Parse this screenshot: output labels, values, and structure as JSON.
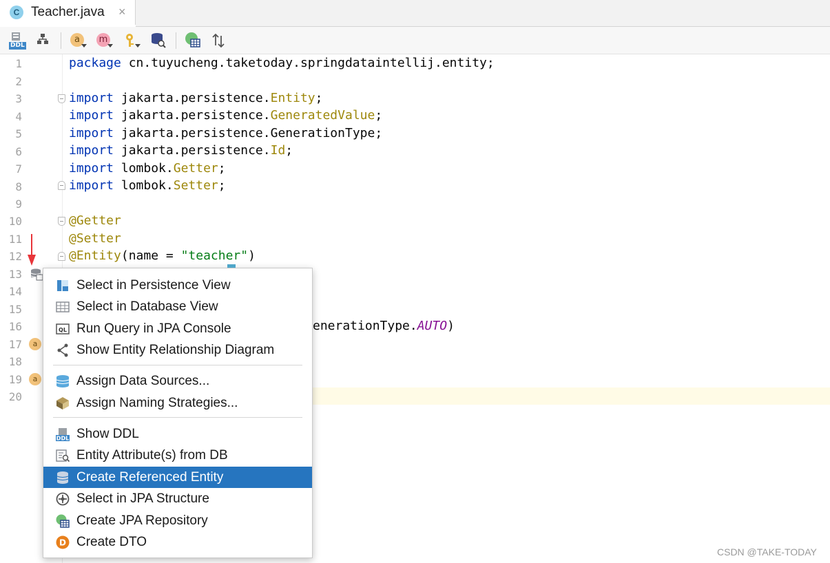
{
  "tab": {
    "title": "Teacher.java",
    "icon_letter": "C",
    "close_glyph": "×"
  },
  "toolbar": {
    "ddl_label": "DDL",
    "attribute_label": "a",
    "method_label": "m"
  },
  "editor": {
    "line_numbers": [
      "1",
      "2",
      "3",
      "4",
      "5",
      "6",
      "7",
      "8",
      "9",
      "10",
      "11",
      "12",
      "13",
      "14",
      "15",
      "16",
      "17",
      "18",
      "19",
      "20"
    ],
    "lines": {
      "l1": {
        "kw": "package",
        "rest": " cn.tuyucheng.taketoday.springdataintellij.entity;"
      },
      "l3": {
        "kw": "import",
        "pre": " jakarta.persistence.",
        "cls": "Entity",
        "post": ";"
      },
      "l4": {
        "kw": "import",
        "pre": " jakarta.persistence.",
        "cls": "GeneratedValue",
        "post": ";"
      },
      "l5": {
        "kw": "import",
        "pre": " jakarta.persistence.GenerationType;"
      },
      "l6": {
        "kw": "import",
        "pre": " jakarta.persistence.",
        "cls": "Id",
        "post": ";"
      },
      "l7": {
        "kw": "import",
        "pre": " lombok.",
        "cls": "Getter",
        "post": ";"
      },
      "l8": {
        "kw": "import",
        "pre": " lombok.",
        "cls": "Setter",
        "post": ";"
      },
      "l10": {
        "ann": "@Getter"
      },
      "l11": {
        "ann": "@Setter"
      },
      "l12": {
        "ann": "@Entity",
        "pre": "(name = ",
        "str": "\"teacher\"",
        "post": ")"
      },
      "l16": {
        "pre": "enerationType.",
        "enum": "AUTO",
        "post": ")"
      }
    },
    "gutter_icons": {
      "l17": "a",
      "l19": "a"
    }
  },
  "popup_menu": {
    "items": [
      {
        "label": "Select in Persistence View",
        "icon": "persistence-view-icon"
      },
      {
        "label": "Select in Database View",
        "icon": "database-view-icon"
      },
      {
        "label": "Run Query in JPA Console",
        "icon": "ql-console-icon",
        "icon_text": "QL"
      },
      {
        "label": "Show Entity Relationship Diagram",
        "icon": "diagram-icon"
      },
      {
        "label": "Assign Data Sources...",
        "icon": "data-sources-icon"
      },
      {
        "label": "Assign Naming Strategies...",
        "icon": "naming-strategies-icon"
      },
      {
        "label": "Show DDL",
        "icon": "ddl-icon",
        "icon_text": "DDL"
      },
      {
        "label": "Entity Attribute(s) from DB",
        "icon": "entity-attributes-icon"
      },
      {
        "label": "Create Referenced Entity",
        "icon": "referenced-entity-icon",
        "selected": true
      },
      {
        "label": "Select in JPA Structure",
        "icon": "jpa-structure-icon"
      },
      {
        "label": "Create JPA Repository",
        "icon": "jpa-repository-icon"
      },
      {
        "label": "Create DTO",
        "icon": "dto-icon",
        "icon_text": "D"
      }
    ]
  },
  "watermark": "CSDN @TAKE-TODAY",
  "colors": {
    "keyword": "#0033b3",
    "annotation": "#9e880d",
    "string": "#067d17",
    "enum_constant": "#871094",
    "selection": "#2675bf",
    "caret_line": "#fffbe6"
  }
}
